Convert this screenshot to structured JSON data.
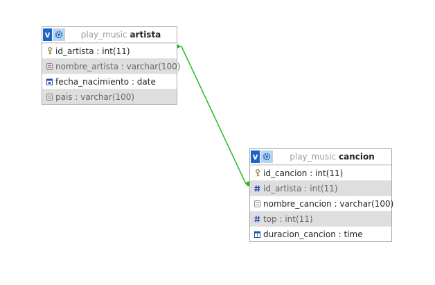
{
  "tables": [
    {
      "id": "artista",
      "db": "play_music",
      "name": "artista",
      "fields": [
        {
          "text": "id_artista : int(11)",
          "icon": "primary-key-icon",
          "alt": false
        },
        {
          "text": "nombre_artista : varchar(100)",
          "icon": "text-field-icon",
          "alt": true
        },
        {
          "text": "fecha_nacimiento : date",
          "icon": "date-field-icon",
          "alt": false
        },
        {
          "text": "pais : varchar(100)",
          "icon": "text-field-icon",
          "alt": true
        }
      ]
    },
    {
      "id": "cancion",
      "db": "play_music",
      "name": "cancion",
      "fields": [
        {
          "text": "id_cancion : int(11)",
          "icon": "primary-key-icon",
          "alt": false
        },
        {
          "text": "id_artista : int(11)",
          "icon": "numeric-field-icon",
          "alt": true
        },
        {
          "text": "nombre_cancion : varchar(100)",
          "icon": "text-field-icon",
          "alt": false
        },
        {
          "text": "top : int(11)",
          "icon": "numeric-field-icon",
          "alt": true
        },
        {
          "text": "duracion_cancion : time",
          "icon": "time-field-icon",
          "alt": false
        }
      ]
    }
  ],
  "colors": {
    "relation_line": "#22bb22",
    "header_v": "#1e64c8",
    "header_gear_bg": "#b9d4ef",
    "alt_row": "#dedede"
  }
}
